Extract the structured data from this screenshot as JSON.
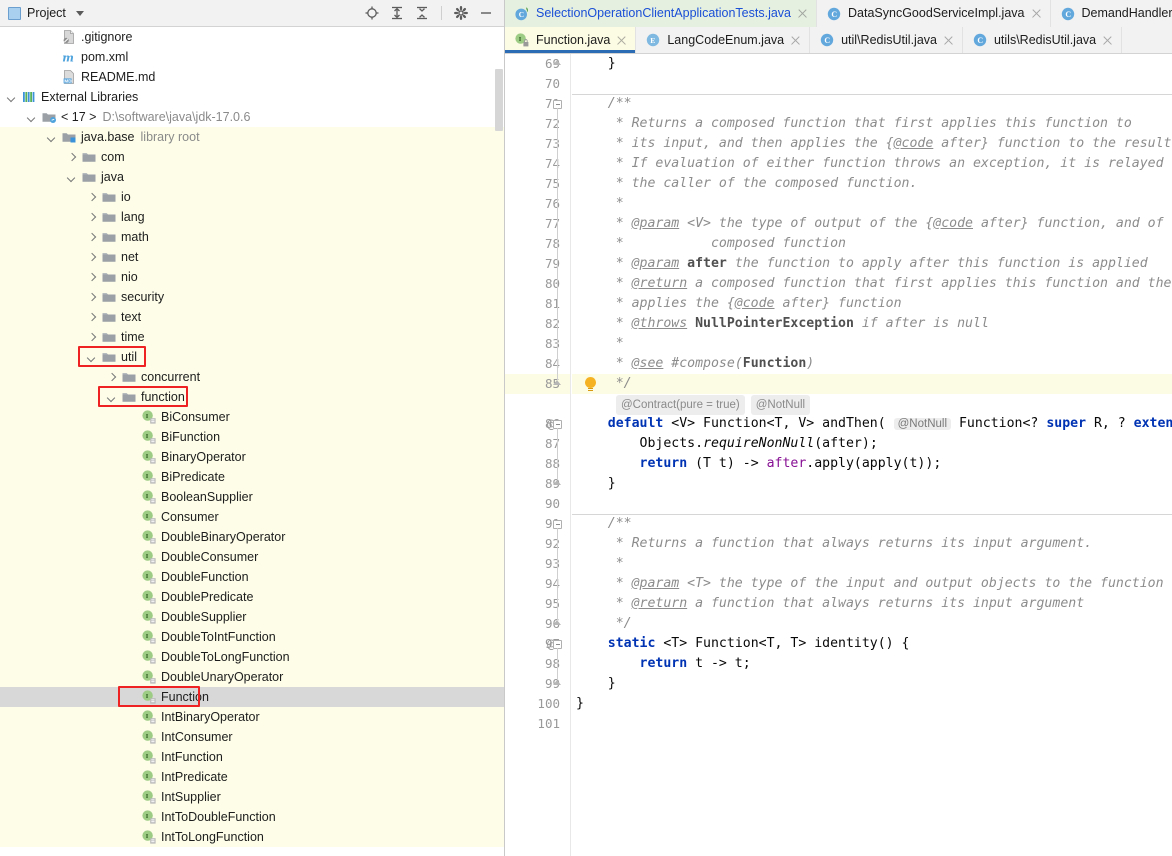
{
  "window": {
    "theme_accent": "#2b6cb5",
    "tree_bg_highlight": "#fdfde8",
    "selection_bg": "#d8d8d8",
    "annotation_color": "#ee2222"
  },
  "project_panel": {
    "title": "Project",
    "caret_icon": "chevron-down-icon",
    "project_icon": "project-window-icon",
    "toolbar": [
      {
        "name": "locate-icon",
        "glyph": "target"
      },
      {
        "name": "expand-all-icon",
        "glyph": "expand"
      },
      {
        "name": "collapse-all-icon",
        "glyph": "collapse"
      },
      {
        "name": "settings-gear-icon",
        "glyph": "gear"
      },
      {
        "name": "hide-window-icon",
        "glyph": "minus"
      }
    ],
    "tree": [
      {
        "id": "gitignore",
        "label": ".gitignore",
        "sub": "",
        "indent": 2,
        "arrow": "none",
        "icon": "gitignore-file-icon",
        "highlight": false,
        "selected": false
      },
      {
        "id": "pomxml",
        "label": "pom.xml",
        "sub": "",
        "indent": 2,
        "arrow": "none",
        "icon": "maven-file-icon",
        "highlight": false,
        "selected": false
      },
      {
        "id": "readme",
        "label": "README.md",
        "sub": "",
        "indent": 2,
        "arrow": "none",
        "icon": "markdown-file-icon",
        "highlight": false,
        "selected": false
      },
      {
        "id": "extlibs",
        "label": "External Libraries",
        "sub": "",
        "indent": 0,
        "arrow": "open",
        "icon": "libraries-icon",
        "highlight": false,
        "selected": false
      },
      {
        "id": "jdk17",
        "label": "< 17 >",
        "sub": "D:\\software\\java\\jdk-17.0.6",
        "indent": 1,
        "arrow": "open",
        "icon": "jdk-icon",
        "highlight": false,
        "selected": false
      },
      {
        "id": "javabase",
        "label": "java.base",
        "sub": "library root",
        "indent": 2,
        "arrow": "open",
        "icon": "module-root-icon",
        "highlight": true,
        "selected": false
      },
      {
        "id": "com",
        "label": "com",
        "sub": "",
        "indent": 3,
        "arrow": "closed",
        "icon": "folder-icon",
        "highlight": true,
        "selected": false
      },
      {
        "id": "java",
        "label": "java",
        "sub": "",
        "indent": 3,
        "arrow": "open",
        "icon": "folder-icon",
        "highlight": true,
        "selected": false
      },
      {
        "id": "io",
        "label": "io",
        "sub": "",
        "indent": 4,
        "arrow": "closed",
        "icon": "folder-icon",
        "highlight": true,
        "selected": false
      },
      {
        "id": "lang",
        "label": "lang",
        "sub": "",
        "indent": 4,
        "arrow": "closed",
        "icon": "folder-icon",
        "highlight": true,
        "selected": false
      },
      {
        "id": "math",
        "label": "math",
        "sub": "",
        "indent": 4,
        "arrow": "closed",
        "icon": "folder-icon",
        "highlight": true,
        "selected": false
      },
      {
        "id": "net",
        "label": "net",
        "sub": "",
        "indent": 4,
        "arrow": "closed",
        "icon": "folder-icon",
        "highlight": true,
        "selected": false
      },
      {
        "id": "nio",
        "label": "nio",
        "sub": "",
        "indent": 4,
        "arrow": "closed",
        "icon": "folder-icon",
        "highlight": true,
        "selected": false
      },
      {
        "id": "security",
        "label": "security",
        "sub": "",
        "indent": 4,
        "arrow": "closed",
        "icon": "folder-icon",
        "highlight": true,
        "selected": false
      },
      {
        "id": "text",
        "label": "text",
        "sub": "",
        "indent": 4,
        "arrow": "closed",
        "icon": "folder-icon",
        "highlight": true,
        "selected": false
      },
      {
        "id": "time",
        "label": "time",
        "sub": "",
        "indent": 4,
        "arrow": "closed",
        "icon": "folder-icon",
        "highlight": true,
        "selected": false
      },
      {
        "id": "util",
        "label": "util",
        "sub": "",
        "indent": 4,
        "arrow": "open",
        "icon": "folder-icon",
        "highlight": true,
        "selected": false,
        "annotated": true
      },
      {
        "id": "concurrent",
        "label": "concurrent",
        "sub": "",
        "indent": 5,
        "arrow": "closed",
        "icon": "folder-icon",
        "highlight": true,
        "selected": false
      },
      {
        "id": "function",
        "label": "function",
        "sub": "",
        "indent": 5,
        "arrow": "open",
        "icon": "folder-icon",
        "highlight": true,
        "selected": false,
        "annotated": true
      },
      {
        "id": "BiConsumer",
        "label": "BiConsumer",
        "sub": "",
        "indent": 6,
        "arrow": "none",
        "icon": "interface-icon",
        "highlight": true,
        "selected": false
      },
      {
        "id": "BiFunction",
        "label": "BiFunction",
        "sub": "",
        "indent": 6,
        "arrow": "none",
        "icon": "interface-icon",
        "highlight": true,
        "selected": false
      },
      {
        "id": "BinaryOperator",
        "label": "BinaryOperator",
        "sub": "",
        "indent": 6,
        "arrow": "none",
        "icon": "interface-icon",
        "highlight": true,
        "selected": false
      },
      {
        "id": "BiPredicate",
        "label": "BiPredicate",
        "sub": "",
        "indent": 6,
        "arrow": "none",
        "icon": "interface-icon",
        "highlight": true,
        "selected": false
      },
      {
        "id": "BooleanSupplier",
        "label": "BooleanSupplier",
        "sub": "",
        "indent": 6,
        "arrow": "none",
        "icon": "interface-icon",
        "highlight": true,
        "selected": false
      },
      {
        "id": "Consumer",
        "label": "Consumer",
        "sub": "",
        "indent": 6,
        "arrow": "none",
        "icon": "interface-icon",
        "highlight": true,
        "selected": false
      },
      {
        "id": "DoubleBinaryOperator",
        "label": "DoubleBinaryOperator",
        "sub": "",
        "indent": 6,
        "arrow": "none",
        "icon": "interface-icon",
        "highlight": true,
        "selected": false
      },
      {
        "id": "DoubleConsumer",
        "label": "DoubleConsumer",
        "sub": "",
        "indent": 6,
        "arrow": "none",
        "icon": "interface-icon",
        "highlight": true,
        "selected": false
      },
      {
        "id": "DoubleFunction",
        "label": "DoubleFunction",
        "sub": "",
        "indent": 6,
        "arrow": "none",
        "icon": "interface-icon",
        "highlight": true,
        "selected": false
      },
      {
        "id": "DoublePredicate",
        "label": "DoublePredicate",
        "sub": "",
        "indent": 6,
        "arrow": "none",
        "icon": "interface-icon",
        "highlight": true,
        "selected": false
      },
      {
        "id": "DoubleSupplier",
        "label": "DoubleSupplier",
        "sub": "",
        "indent": 6,
        "arrow": "none",
        "icon": "interface-icon",
        "highlight": true,
        "selected": false
      },
      {
        "id": "DoubleToIntFunction",
        "label": "DoubleToIntFunction",
        "sub": "",
        "indent": 6,
        "arrow": "none",
        "icon": "interface-icon",
        "highlight": true,
        "selected": false
      },
      {
        "id": "DoubleToLongFunction",
        "label": "DoubleToLongFunction",
        "sub": "",
        "indent": 6,
        "arrow": "none",
        "icon": "interface-icon",
        "highlight": true,
        "selected": false
      },
      {
        "id": "DoubleUnaryOperator",
        "label": "DoubleUnaryOperator",
        "sub": "",
        "indent": 6,
        "arrow": "none",
        "icon": "interface-icon",
        "highlight": true,
        "selected": false
      },
      {
        "id": "Function",
        "label": "Function",
        "sub": "",
        "indent": 6,
        "arrow": "none",
        "icon": "interface-icon",
        "highlight": false,
        "selected": true,
        "annotated": true
      },
      {
        "id": "IntBinaryOperator",
        "label": "IntBinaryOperator",
        "sub": "",
        "indent": 6,
        "arrow": "none",
        "icon": "interface-icon",
        "highlight": true,
        "selected": false
      },
      {
        "id": "IntConsumer",
        "label": "IntConsumer",
        "sub": "",
        "indent": 6,
        "arrow": "none",
        "icon": "interface-icon",
        "highlight": true,
        "selected": false
      },
      {
        "id": "IntFunction",
        "label": "IntFunction",
        "sub": "",
        "indent": 6,
        "arrow": "none",
        "icon": "interface-icon",
        "highlight": true,
        "selected": false
      },
      {
        "id": "IntPredicate",
        "label": "IntPredicate",
        "sub": "",
        "indent": 6,
        "arrow": "none",
        "icon": "interface-icon",
        "highlight": true,
        "selected": false
      },
      {
        "id": "IntSupplier",
        "label": "IntSupplier",
        "sub": "",
        "indent": 6,
        "arrow": "none",
        "icon": "interface-icon",
        "highlight": true,
        "selected": false
      },
      {
        "id": "IntToDoubleFunction",
        "label": "IntToDoubleFunction",
        "sub": "",
        "indent": 6,
        "arrow": "none",
        "icon": "interface-icon",
        "highlight": true,
        "selected": false
      },
      {
        "id": "IntToLongFunction",
        "label": "IntToLongFunction",
        "sub": "",
        "indent": 6,
        "arrow": "none",
        "icon": "interface-icon",
        "highlight": true,
        "selected": false
      }
    ]
  },
  "editor": {
    "tab_rows": [
      [
        {
          "label": "SelectionOperationClientApplicationTests.java",
          "icon": "test-class-icon",
          "state": "vcs-modified",
          "closable": true
        },
        {
          "label": "DataSyncGoodServiceImpl.java",
          "icon": "class-icon",
          "state": "normal",
          "closable": true
        },
        {
          "label": "DemandHandler.java",
          "icon": "class-icon",
          "state": "normal",
          "closable": false
        }
      ],
      [
        {
          "label": "Function.java",
          "icon": "interface-readonly-icon",
          "state": "active",
          "closable": true
        },
        {
          "label": "LangCodeEnum.java",
          "icon": "enum-icon",
          "state": "normal",
          "closable": true
        },
        {
          "label": "util\\RedisUtil.java",
          "icon": "class-icon",
          "state": "normal",
          "closable": true
        },
        {
          "label": "utils\\RedisUtil.java",
          "icon": "class-icon",
          "state": "normal",
          "closable": true
        }
      ]
    ],
    "first_line_number": 69,
    "last_line_number": 101,
    "highlighted_line": 85,
    "lightbulb_line": 85,
    "at_marker_lines": [
      86,
      97
    ],
    "inline_annotation_chips": [
      "@Contract(pure = true)",
      "@NotNull"
    ],
    "lines": [
      {
        "n": 69,
        "text": "    }"
      },
      {
        "n": 70,
        "text": ""
      },
      {
        "n": 71,
        "text": "    /**"
      },
      {
        "n": 72,
        "text": "     * Returns a composed function that first applies this function to"
      },
      {
        "n": 73,
        "text": "     * its input, and then applies the {@code after} function to the result."
      },
      {
        "n": 74,
        "text": "     * If evaluation of either function throws an exception, it is relayed to"
      },
      {
        "n": 75,
        "text": "     * the caller of the composed function."
      },
      {
        "n": 76,
        "text": "     *"
      },
      {
        "n": 77,
        "text": "     * @param <V> the type of output of the {@code after} function, and of the"
      },
      {
        "n": 78,
        "text": "     *           composed function"
      },
      {
        "n": 79,
        "text": "     * @param after the function to apply after this function is applied"
      },
      {
        "n": 80,
        "text": "     * @return a composed function that first applies this function and then"
      },
      {
        "n": 81,
        "text": "     * applies the {@code after} function"
      },
      {
        "n": 82,
        "text": "     * @throws NullPointerException if after is null"
      },
      {
        "n": 83,
        "text": "     *"
      },
      {
        "n": 84,
        "text": "     * @see #compose(Function)"
      },
      {
        "n": 85,
        "text": "     */"
      },
      {
        "n": 86,
        "text": "    default <V> Function<T, V> andThen( @NotNull Function<? super R, ? extends V> after) {"
      },
      {
        "n": 87,
        "text": "        Objects.requireNonNull(after);"
      },
      {
        "n": 88,
        "text": "        return (T t) -> after.apply(apply(t));"
      },
      {
        "n": 89,
        "text": "    }"
      },
      {
        "n": 90,
        "text": ""
      },
      {
        "n": 91,
        "text": "    /**"
      },
      {
        "n": 92,
        "text": "     * Returns a function that always returns its input argument."
      },
      {
        "n": 93,
        "text": "     *"
      },
      {
        "n": 94,
        "text": "     * @param <T> the type of the input and output objects to the function"
      },
      {
        "n": 95,
        "text": "     * @return a function that always returns its input argument"
      },
      {
        "n": 96,
        "text": "     */"
      },
      {
        "n": 97,
        "text": "    static <T> Function<T, T> identity() {"
      },
      {
        "n": 98,
        "text": "        return t -> t;"
      },
      {
        "n": 99,
        "text": "    }"
      },
      {
        "n": 100,
        "text": "}"
      },
      {
        "n": 101,
        "text": ""
      }
    ]
  }
}
